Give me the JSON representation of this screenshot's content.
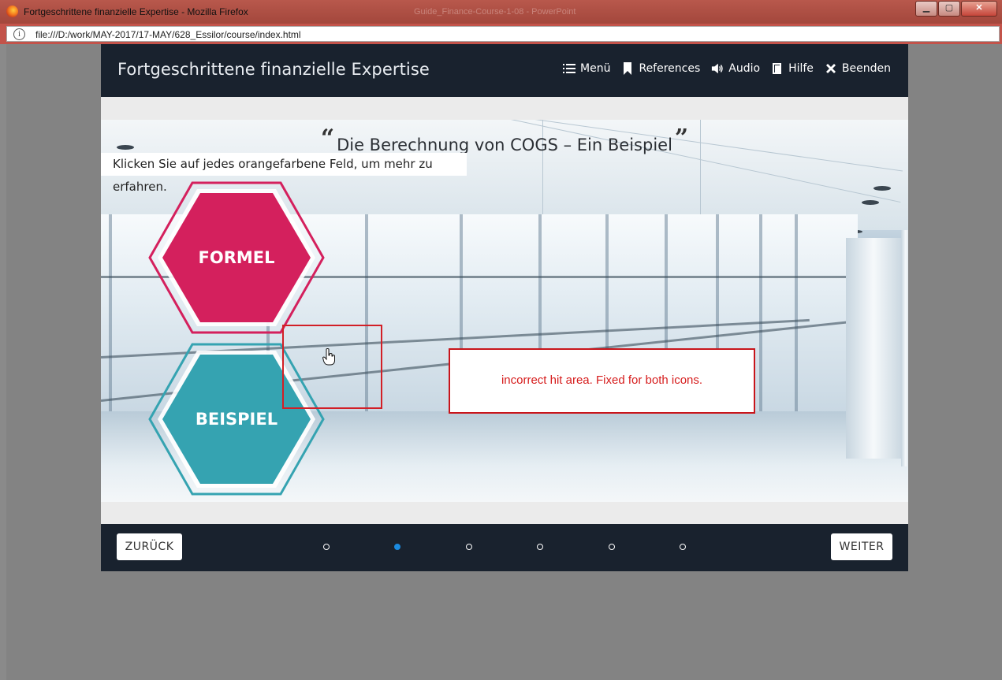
{
  "window": {
    "title": "Fortgeschrittene finanzielle Expertise - Mozilla Firefox",
    "background_title": "Guide_Finance-Course-1-08 - PowerPoint",
    "url": "file:///D:/work/MAY-2017/17-MAY/628_Essilor/course/index.html",
    "controls": {
      "minimize": "▁",
      "maximize": "▢",
      "close": "✕"
    }
  },
  "header": {
    "course_title": "Fortgeschrittene finanzielle Expertise",
    "nav": [
      {
        "label": "Menü",
        "icon": "list-icon"
      },
      {
        "label": "References",
        "icon": "bookmark-icon"
      },
      {
        "label": "Audio",
        "icon": "speaker-icon"
      },
      {
        "label": "Hilfe",
        "icon": "book-icon"
      },
      {
        "label": "Beenden",
        "icon": "close-icon"
      }
    ]
  },
  "slide": {
    "open_quote": "“",
    "title": "Die Berechnung von COGS – Ein Beispiel",
    "close_quote": "”",
    "instruction": "Klicken Sie auf jedes orangefarbene Feld, um mehr zu erfahren.",
    "buttons": [
      {
        "label": "FORMEL",
        "color": "#d4205d"
      },
      {
        "label": "BEISPIEL",
        "color": "#35a3b1"
      }
    ],
    "annotation": "incorrect hit area. Fixed for both icons."
  },
  "footer": {
    "back_label": "ZURÜCK",
    "next_label": "WEITER",
    "page_count": 6,
    "current_page": 2
  },
  "colors": {
    "bar_bg": "#19222e",
    "active_dot": "#1b8be0",
    "annotation_red": "#d21f26"
  }
}
